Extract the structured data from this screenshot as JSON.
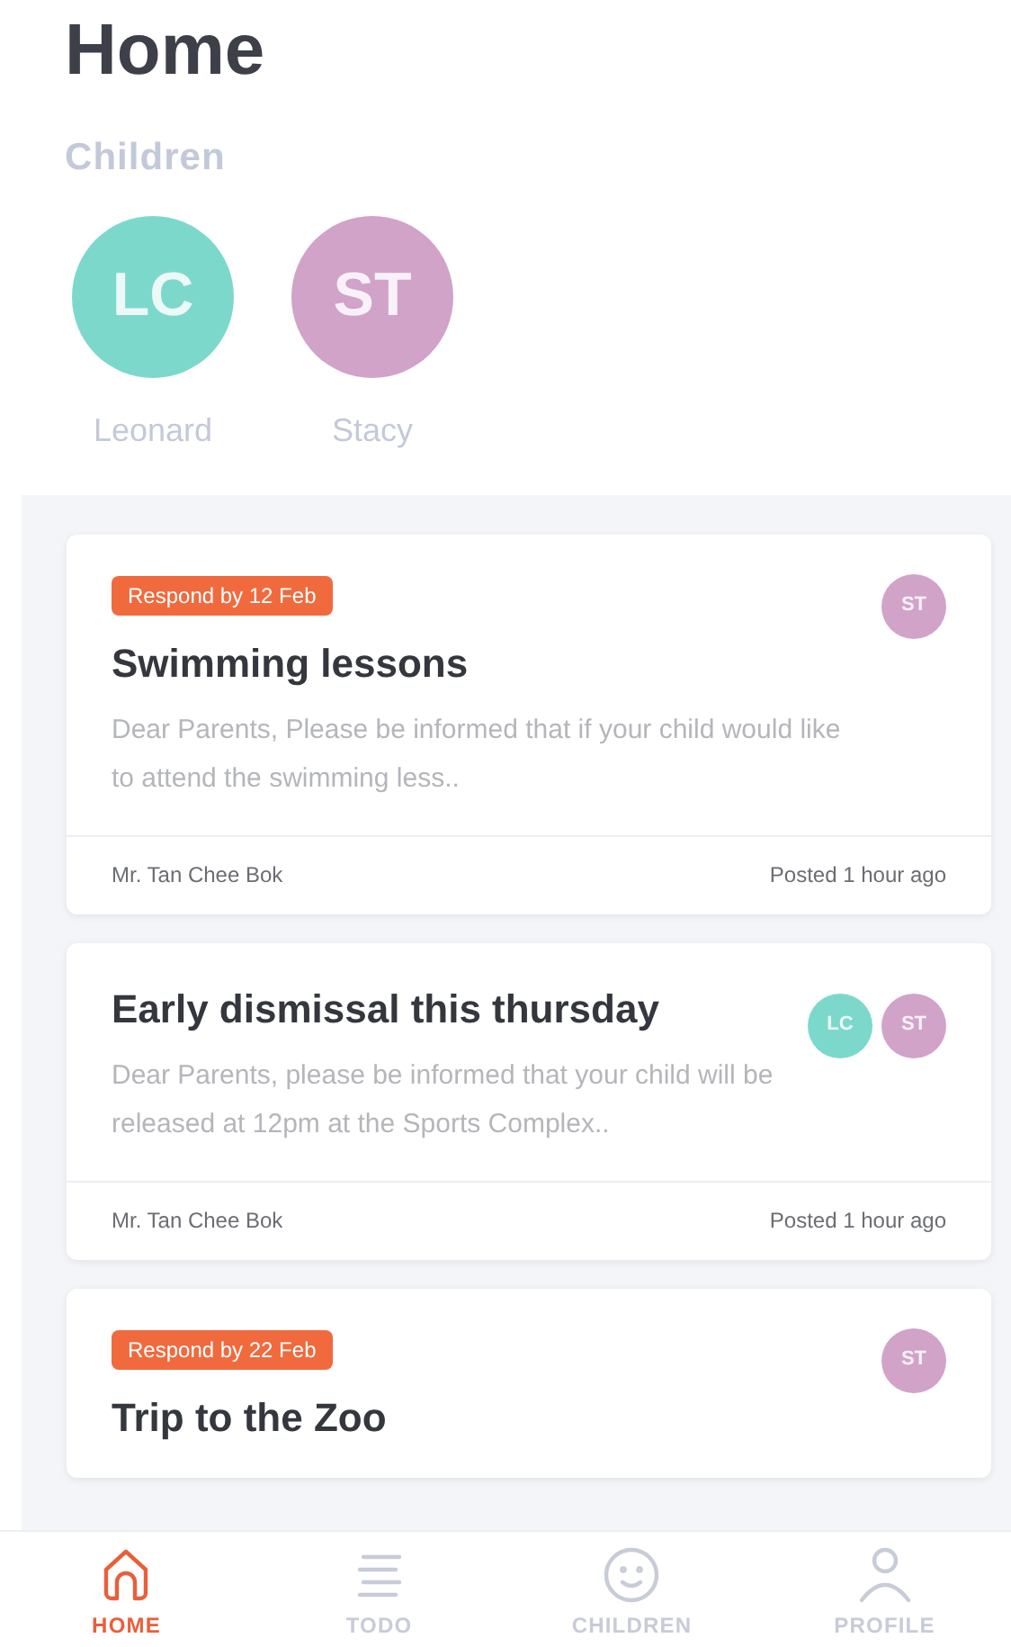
{
  "title": "Home",
  "children_heading": "Children",
  "children": [
    {
      "initials": "LC",
      "name": "Leonard",
      "color": "#7dd8cc"
    },
    {
      "initials": "ST",
      "name": "Stacy",
      "color": "#d1a3c9"
    }
  ],
  "posts": [
    {
      "badge": "Respond by 12 Feb",
      "title": "Swimming lessons",
      "body": "Dear Parents, Please be informed that if your child would like to attend the swimming less..",
      "avatars": [
        {
          "initials": "ST",
          "color": "#d1a3c9"
        }
      ],
      "author": "Mr. Tan Chee Bok",
      "time": "Posted 1 hour ago"
    },
    {
      "title": "Early dismissal this thursday",
      "body": "Dear Parents, please be informed that your child will be released at 12pm at the Sports Complex..",
      "avatars": [
        {
          "initials": "LC",
          "color": "#7dd8cc"
        },
        {
          "initials": "ST",
          "color": "#d1a3c9"
        }
      ],
      "author": "Mr. Tan Chee Bok",
      "time": "Posted 1 hour ago"
    },
    {
      "badge": "Respond by 22 Feb",
      "title": "Trip to the Zoo",
      "avatars": [
        {
          "initials": "ST",
          "color": "#d1a3c9"
        }
      ]
    }
  ],
  "nav": [
    {
      "kind": "home",
      "label": "HOME",
      "selected": true
    },
    {
      "kind": "todo",
      "label": "TODO",
      "selected": false
    },
    {
      "kind": "children",
      "label": "CHILDREN",
      "selected": false
    },
    {
      "kind": "profile",
      "label": "PROFILE",
      "selected": false
    }
  ]
}
